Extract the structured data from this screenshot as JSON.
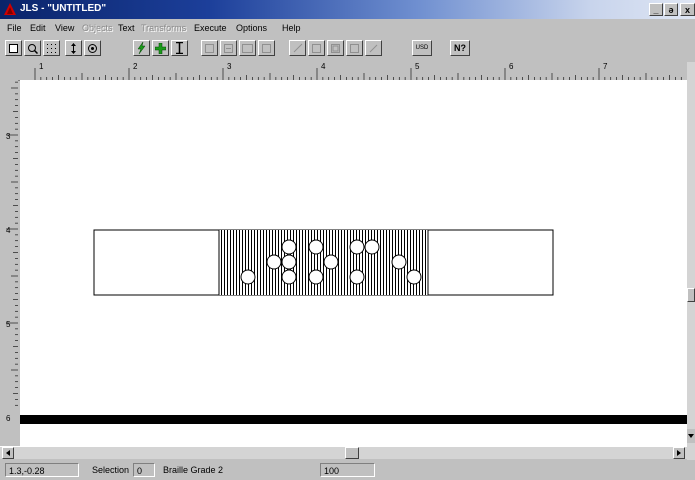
{
  "window": {
    "title": "JLS - \"UNTITLED\"",
    "min_label": "_",
    "max_label": "ə",
    "close_label": "x"
  },
  "menu": [
    {
      "label": "File",
      "enabled": true
    },
    {
      "label": "Edit",
      "enabled": true
    },
    {
      "label": "View",
      "enabled": true
    },
    {
      "label": "Objects",
      "enabled": false
    },
    {
      "label": "Text",
      "enabled": true
    },
    {
      "label": "Transforms",
      "enabled": false
    },
    {
      "label": "Execute",
      "enabled": true
    },
    {
      "label": "Options",
      "enabled": true
    },
    {
      "label": "Help",
      "enabled": true
    }
  ],
  "toolbar": {
    "items": [
      "new-page-icon",
      "zoom-icon",
      "grid-icon",
      "move-icon",
      "view-icon",
      "lightning-icon",
      "add-icon",
      "text-cursor-icon",
      "disabled-tool-1",
      "disabled-tool-2",
      "disabled-tool-3",
      "disabled-tool-4",
      "disabled-tool-5",
      "disabled-tool-6",
      "disabled-tool-7",
      "disabled-tool-8",
      "disabled-tool-9"
    ],
    "usd_label": "USD",
    "help_label": "N?"
  },
  "ruler": {
    "top_labels": [
      "1",
      "2",
      "3",
      "4",
      "5",
      "6",
      "7"
    ],
    "left_labels": [
      "3",
      "4",
      "5",
      "6"
    ]
  },
  "status": {
    "coords": "1.3,-0.28",
    "selection_label": "Selection",
    "selection_value": "0",
    "mode": "Braille Grade 2",
    "zoom": "100"
  },
  "colors": {
    "title_bar": "#0a246a",
    "chrome": "#c0c0c0",
    "canvas": "#ffffff"
  }
}
